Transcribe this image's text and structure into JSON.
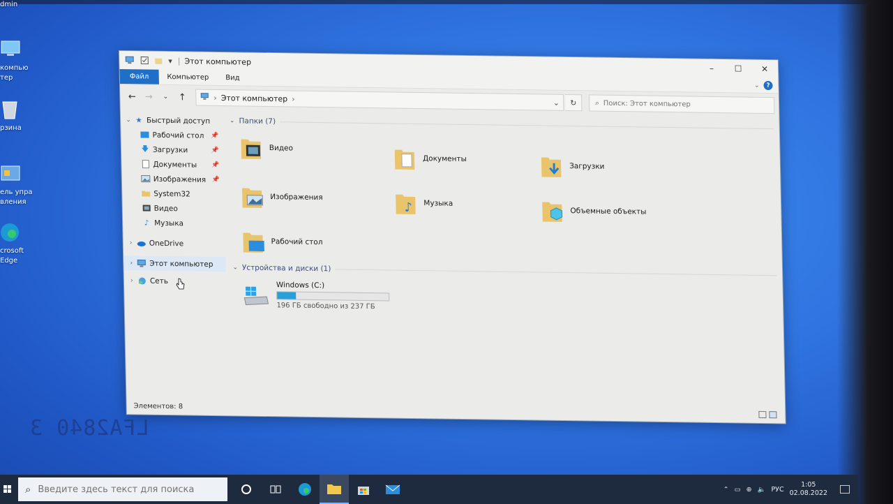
{
  "desktop": {
    "icons": [
      {
        "label": "dmin"
      },
      {
        "label": "компью\nтер"
      },
      {
        "label": "рзина"
      },
      {
        "label": "ель упра\nвления"
      },
      {
        "label": "crosoft\nEdge"
      }
    ]
  },
  "window": {
    "title": "Этот компьютер",
    "ribbon": {
      "file": "Файл",
      "computer": "Компьютер",
      "view": "Вид"
    },
    "address": {
      "path": "Этот компьютер"
    },
    "search": {
      "placeholder": "Поиск: Этот компьютер"
    },
    "sidebar": {
      "quick_access": "Быстрый доступ",
      "quick_items": [
        "Рабочий стол",
        "Загрузки",
        "Документы",
        "Изображения",
        "System32",
        "Видео",
        "Музыка"
      ],
      "onedrive": "OneDrive",
      "this_pc": "Этот компьютер",
      "network": "Сеть"
    },
    "folders_group": "Папки (7)",
    "folders": [
      "Видео",
      "Документы",
      "Загрузки",
      "Изображения",
      "Музыка",
      "Объемные объекты",
      "Рабочий стол"
    ],
    "devices_group": "Устройства и диски (1)",
    "drive": {
      "name": "Windows (C:)",
      "free_text": "196 ГБ свободно из 237 ГБ",
      "used_fraction": 0.17
    },
    "status": "Элементов: 8"
  },
  "sticker": {
    "text": "LFA2840 3"
  },
  "taskbar": {
    "search_placeholder": "Введите здесь текст для поиска",
    "lang": "РУС",
    "time": "1:05",
    "date": "02.08.2022"
  },
  "colors": {
    "accent": "#1f6fc9",
    "drive_fill": "#26a0da",
    "taskbar": "#1e2a3e"
  }
}
